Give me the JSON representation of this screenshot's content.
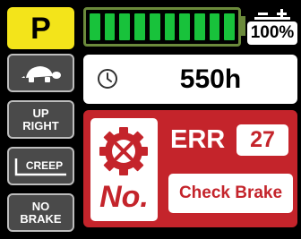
{
  "gear": {
    "label": "P"
  },
  "side_buttons": {
    "turtle": {
      "icon": "turtle-icon"
    },
    "up_right": {
      "label_1": "UP",
      "label_2": "RIGHT"
    },
    "creep": {
      "label": "CREEP"
    },
    "no_brake": {
      "label_1": "NO",
      "label_2": "BRAKE"
    }
  },
  "battery": {
    "level_percent": 100,
    "segments": 10,
    "percent_label": "100%",
    "icon": "battery-plus-minus-icon"
  },
  "hours": {
    "icon": "clock-icon",
    "value": "550h"
  },
  "error": {
    "icon": "gear-wrench-icon",
    "no_label": "No.",
    "label": "ERR",
    "code": "27",
    "message": "Check Brake"
  },
  "colors": {
    "yellow": "#f3e41a",
    "battery_green": "#18c23b",
    "error_red": "#c4242b",
    "button_gray": "#4a4a4a"
  }
}
